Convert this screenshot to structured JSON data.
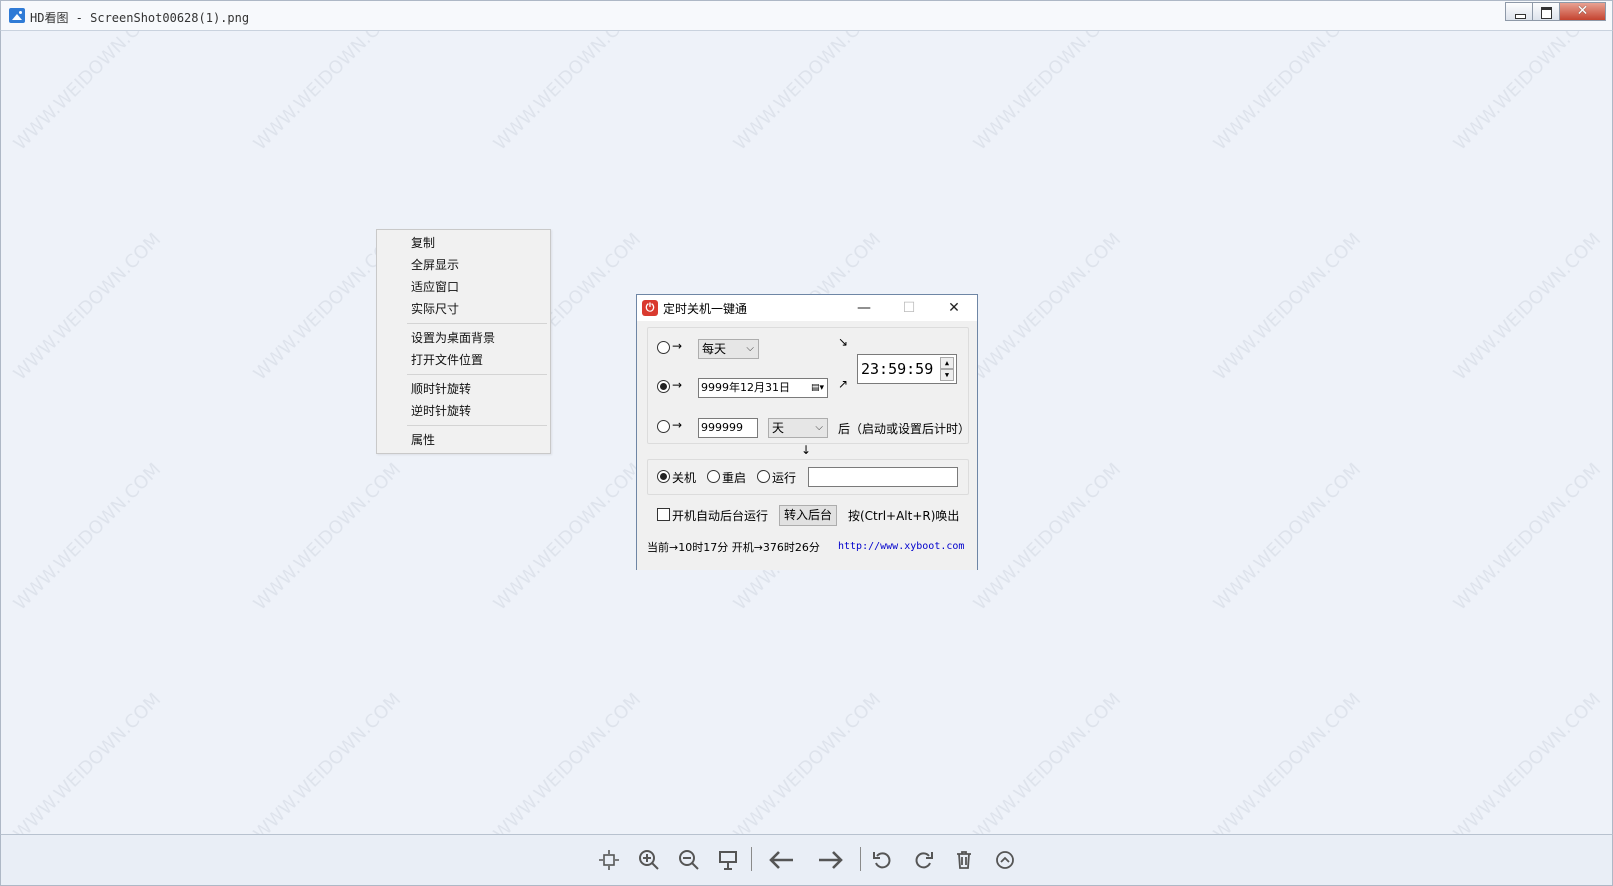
{
  "window": {
    "title": "HD看图 - ScreenShot00628(1).png",
    "minimize": "",
    "maximize": "",
    "close": "✕"
  },
  "watermark": "WWW.WEIDOWN.COM",
  "context_menu": {
    "items": [
      "复制",
      "全屏显示",
      "适应窗口",
      "实际尺寸",
      "设置为桌面背景",
      "打开文件位置",
      "顺时针旋转",
      "逆时针旋转",
      "属性"
    ]
  },
  "dialog": {
    "title": "定时关机一键通",
    "icon_text": "⏻",
    "minimize": "—",
    "maximize": "☐",
    "close": "✕",
    "row1": {
      "combo": "每天"
    },
    "row2": {
      "date": "9999年12月31日"
    },
    "row3": {
      "number": "999999",
      "unit": "天",
      "label": "后（启动或设置后计时）"
    },
    "time": "23:59:59",
    "actions": {
      "shutdown": "关机",
      "restart": "重启",
      "run": "运行",
      "run_value": ""
    },
    "autostart_label": "开机自动后台运行",
    "background_button": "转入后台",
    "hotkey_label": "按(Ctrl+Alt+R)唤出",
    "status": "当前→10时17分 开机→376时26分",
    "url": "http://www.xyboot.com"
  },
  "toolbar": {
    "icons": [
      "fit-window-icon",
      "zoom-in-icon",
      "zoom-out-icon",
      "slideshow-icon",
      "prev-arrow-icon",
      "next-arrow-icon",
      "rotate-left-icon",
      "rotate-right-icon",
      "delete-icon",
      "more-icon"
    ]
  }
}
